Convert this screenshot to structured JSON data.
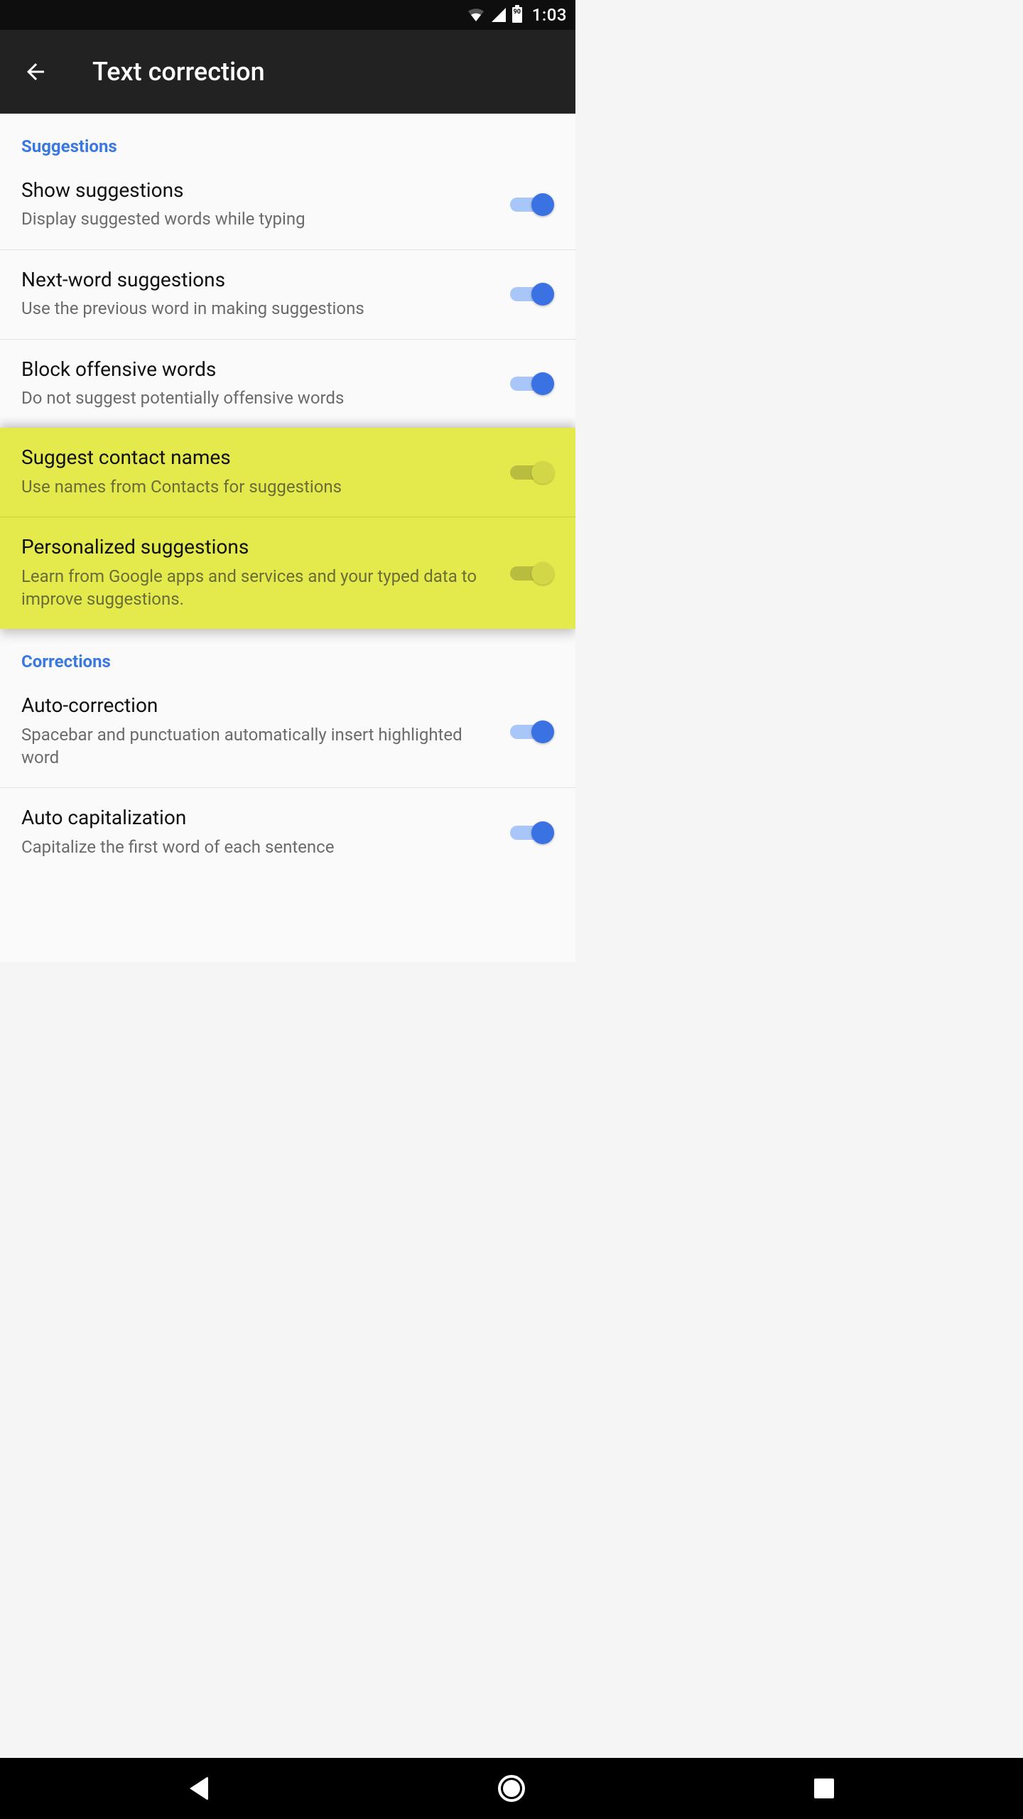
{
  "status": {
    "battery_pct": "90",
    "clock": "1:03"
  },
  "header": {
    "title": "Text correction"
  },
  "sections": {
    "suggestions": {
      "label": "Suggestions",
      "items": [
        {
          "title": "Show suggestions",
          "subtitle": "Display suggested words while typing",
          "on": true
        },
        {
          "title": "Next-word suggestions",
          "subtitle": "Use the previous word in making suggestions",
          "on": true
        },
        {
          "title": "Block offensive words",
          "subtitle": "Do not suggest potentially offensive words",
          "on": true
        },
        {
          "title": "Suggest contact names",
          "subtitle": "Use names from Contacts for suggestions",
          "on": true
        },
        {
          "title": "Personalized suggestions",
          "subtitle": "Learn from Google apps and services and your typed data to improve suggestions.",
          "on": true
        }
      ]
    },
    "corrections": {
      "label": "Corrections",
      "items": [
        {
          "title": "Auto-correction",
          "subtitle": "Spacebar and punctuation automatically insert highlighted word",
          "on": true
        },
        {
          "title": "Auto capitalization",
          "subtitle": "Capitalize the first word of each sentence",
          "on": true
        }
      ]
    }
  },
  "colors": {
    "accent": "#3a72e3",
    "section_header": "#3a78e0",
    "highlight_bg": "#e4ea4c"
  }
}
